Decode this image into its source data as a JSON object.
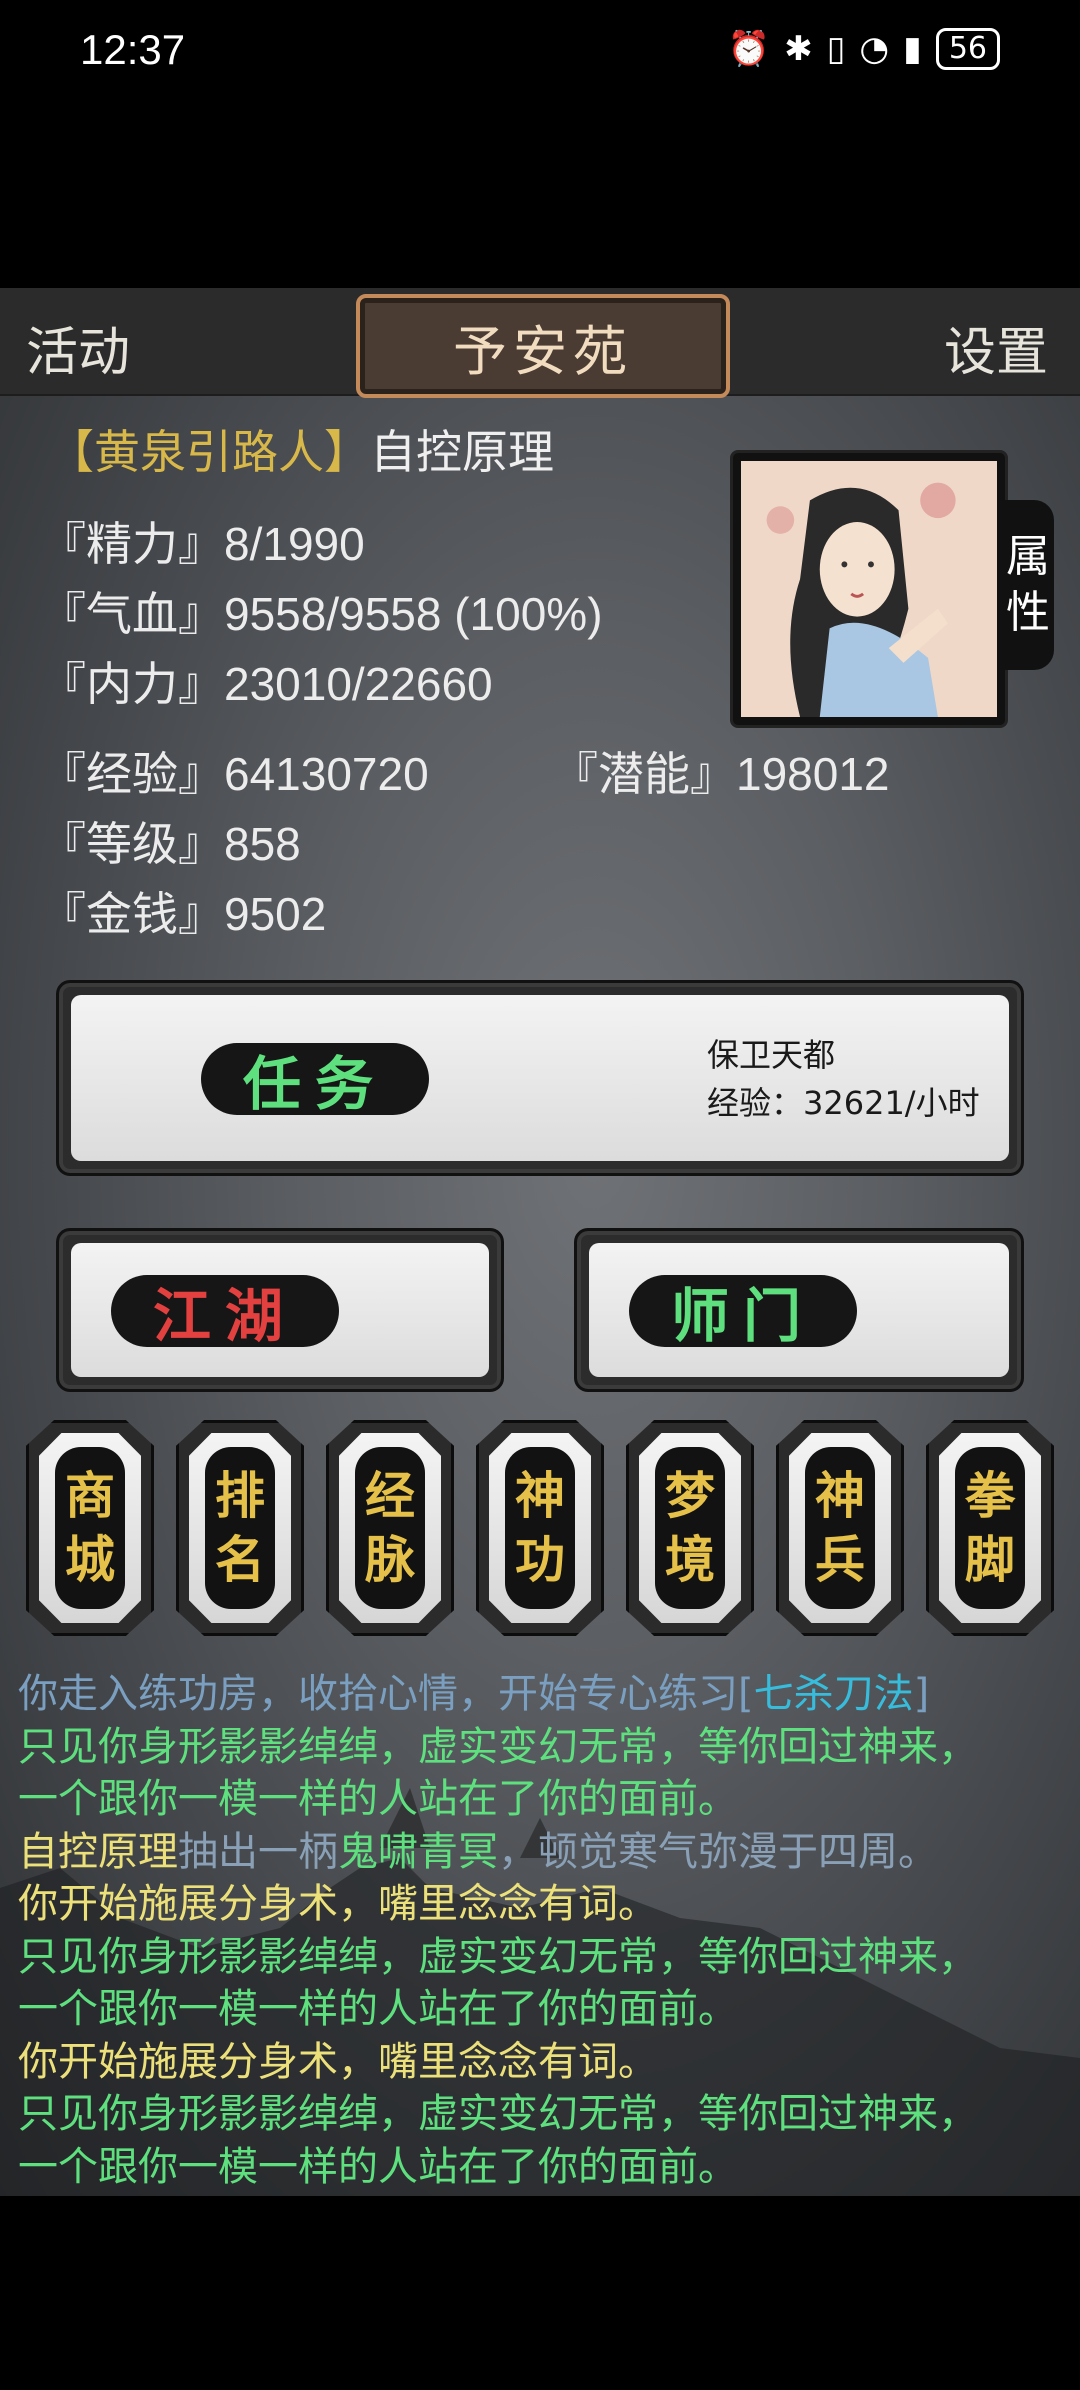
{
  "status_bar": {
    "time": "12:37",
    "battery": "56"
  },
  "top_bar": {
    "left_label": "活动",
    "title": "予安苑",
    "right_label": "设置"
  },
  "character": {
    "tag": "【黄泉引路人】",
    "name": "自控原理",
    "attr_tab": [
      "属",
      "性"
    ]
  },
  "stats": {
    "jingli": {
      "label": "『精力』",
      "value": "8/1990"
    },
    "qixue": {
      "label": "『气血』",
      "value": "9558/9558 (100%)"
    },
    "neili": {
      "label": "『内力』",
      "value": "23010/22660"
    },
    "jingyan": {
      "label": "『经验』",
      "value": "64130720"
    },
    "qianneng": {
      "label": "『潜能』",
      "value": "198012"
    },
    "dengji": {
      "label": "『等级』",
      "value": "858"
    },
    "jinqian": {
      "label": "『金钱』",
      "value": "9502"
    }
  },
  "task": {
    "label": "任务",
    "info_line1": "保卫天都",
    "info_line2": "经验：32621/小时"
  },
  "buttons": {
    "jianghu": "江湖",
    "shimen": "师门"
  },
  "tokens": [
    [
      "商",
      "城"
    ],
    [
      "排",
      "名"
    ],
    [
      "经",
      "脉"
    ],
    [
      "神",
      "功"
    ],
    [
      "梦",
      "境"
    ],
    [
      "神",
      "兵"
    ],
    [
      "拳",
      "脚"
    ]
  ],
  "log": {
    "l1a": "你走入练功房，收拾心情，开始专心练习[",
    "l1b": "七杀刀法",
    "l1c": "]",
    "l2": "只见你身形影影绰绰，虚实变幻无常，等你回过神来，",
    "l3": "一个跟你一模一样的人站在了你的面前。",
    "l4a": "自控原理",
    "l4b": "抽出一柄",
    "l4c": "鬼啸青冥",
    "l4d": "，顿觉寒气弥漫于四周。",
    "l5": "你开始施展分身术，嘴里念念有词。",
    "l6": "只见你身形影影绰绰，虚实变幻无常，等你回过神来，",
    "l7": "一个跟你一模一样的人站在了你的面前。",
    "l8": "你开始施展分身术，嘴里念念有词。",
    "l9": "只见你身形影影绰绰，虚实变幻无常，等你回过神来，",
    "l10": "一个跟你一模一样的人站在了你的面前。"
  },
  "colors": {
    "gold": "#d9b84a",
    "green": "#5ee07f",
    "red": "#e34040",
    "cyan": "#38bcdc",
    "yellow": "#ece07a"
  }
}
